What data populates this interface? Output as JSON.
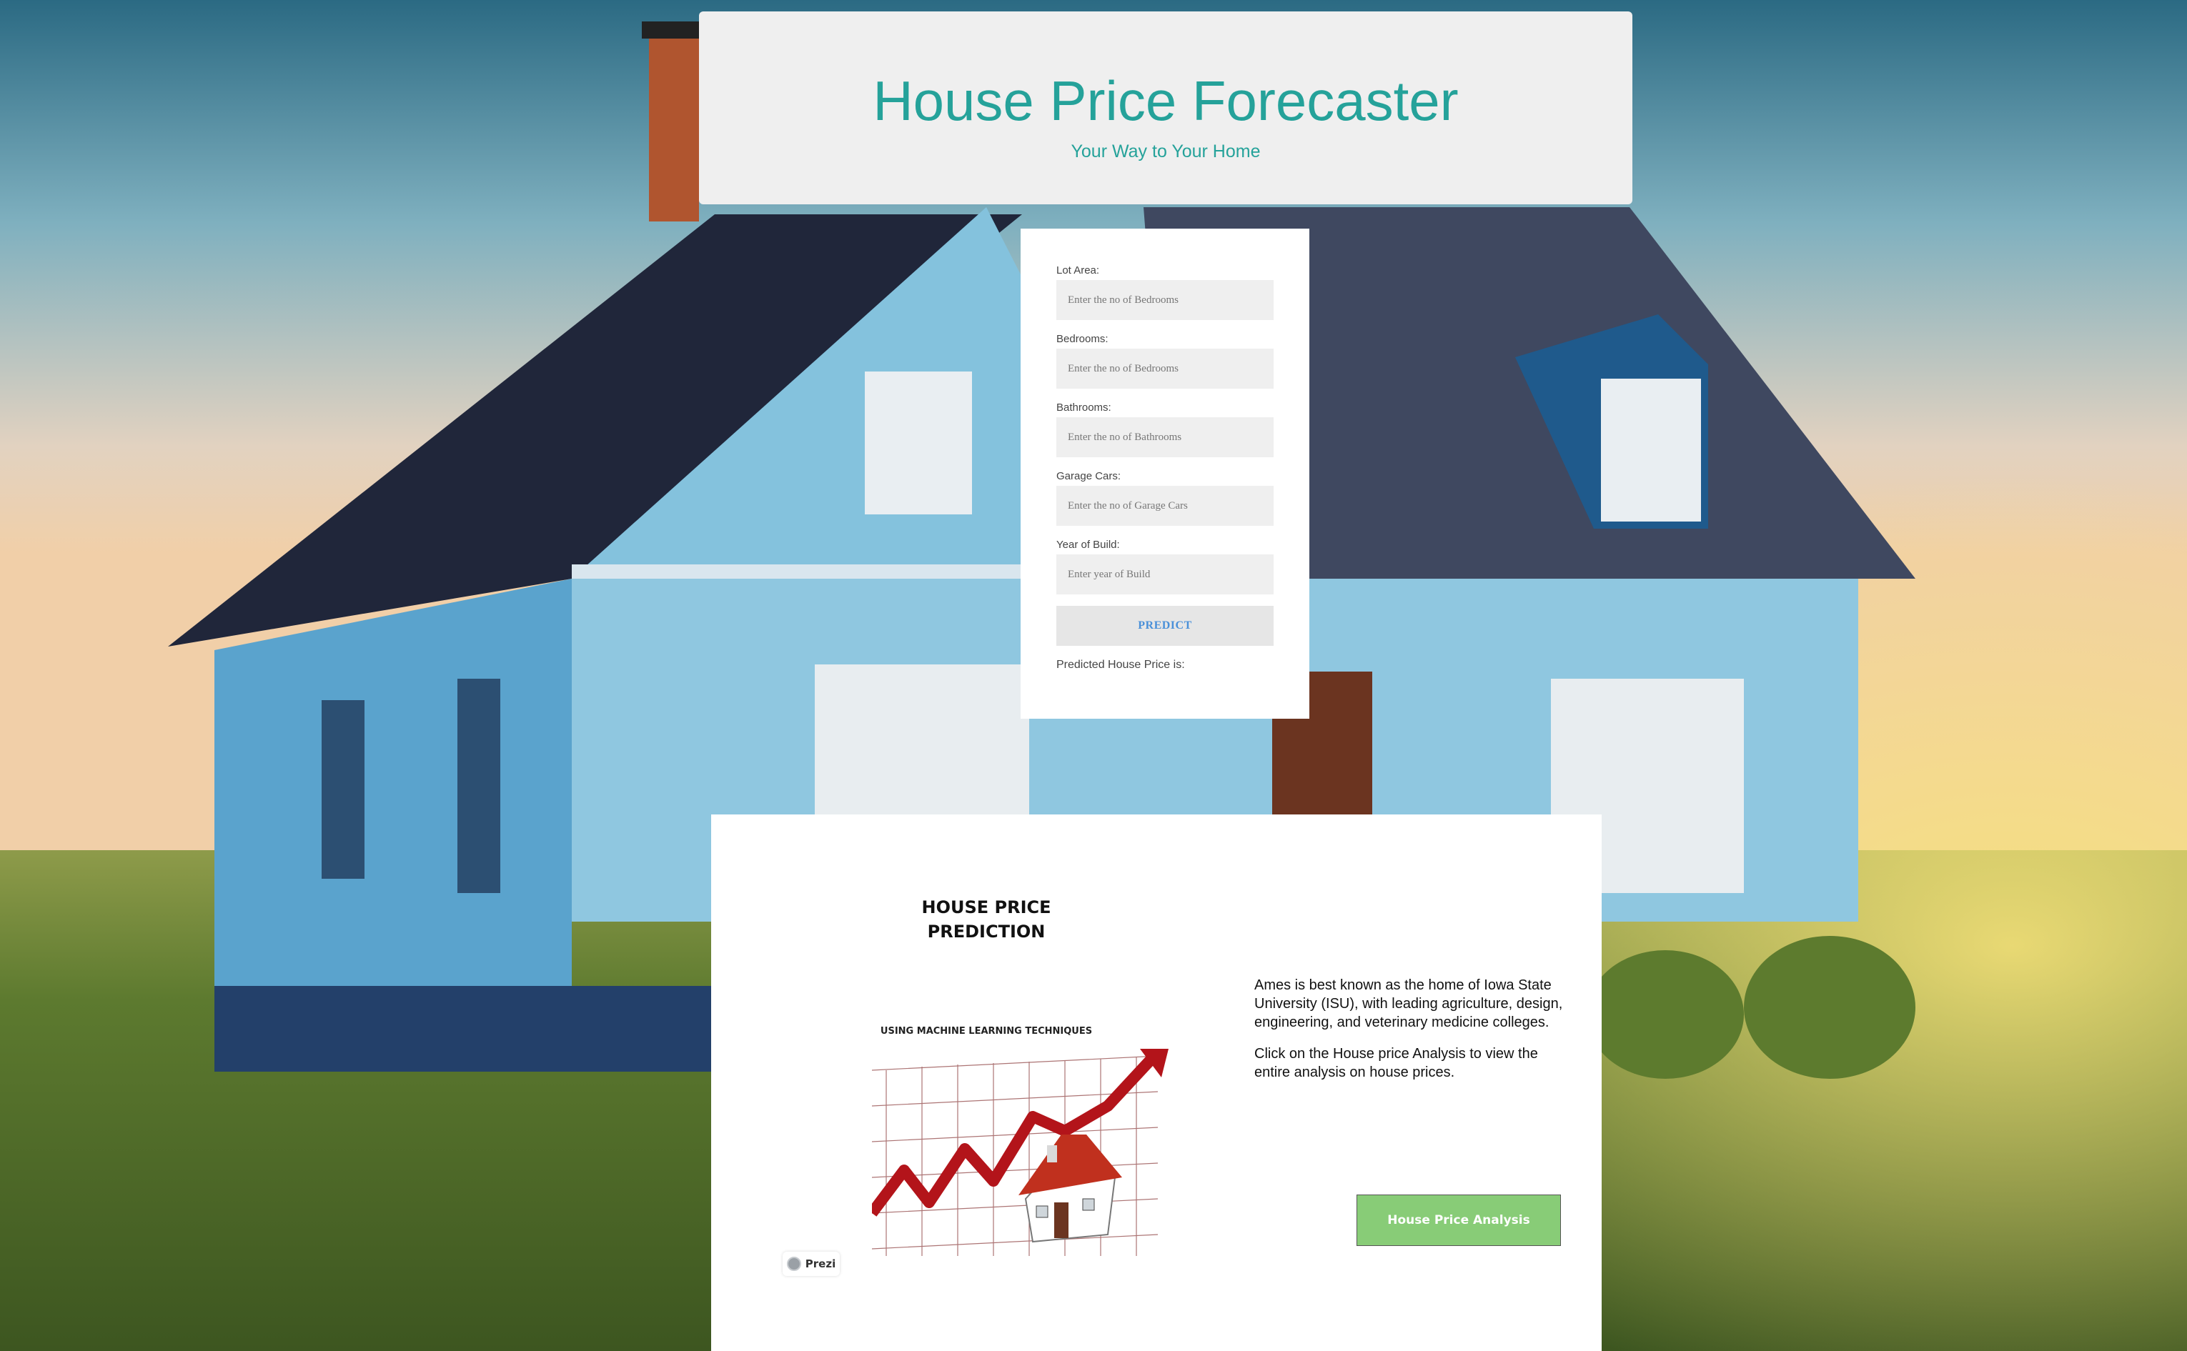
{
  "header": {
    "title": "House Price Forecaster",
    "tagline": "Your Way to Your Home"
  },
  "form": {
    "fields": [
      {
        "label": "Lot Area:",
        "placeholder": "Enter the no of Bedrooms"
      },
      {
        "label": "Bedrooms:",
        "placeholder": "Enter the no of Bedrooms"
      },
      {
        "label": "Bathrooms:",
        "placeholder": "Enter the no of Bathrooms"
      },
      {
        "label": "Garage Cars:",
        "placeholder": "Enter the no of Garage Cars"
      },
      {
        "label": "Year of Build:",
        "placeholder": "Enter year of Build"
      }
    ],
    "predict_label": "PREDICT",
    "result_label": "Predicted House Price is:"
  },
  "info": {
    "prezi": {
      "title_line1": "HOUSE PRICE",
      "title_line2": "PREDICTION",
      "subtitle": "USING MACHINE LEARNING TECHNIQUES",
      "badge": "Prezi"
    },
    "paragraph1": "Ames is best known as the home of Iowa State University (ISU), with leading agriculture, design, engineering, and veterinary medicine colleges.",
    "paragraph2": "Click on the House price Analysis to view the entire analysis on house prices.",
    "analysis_button": "House Price Analysis"
  },
  "colors": {
    "accent": "#25a29a",
    "predict_text": "#4a90d9",
    "analysis_button": "#88cc77"
  }
}
